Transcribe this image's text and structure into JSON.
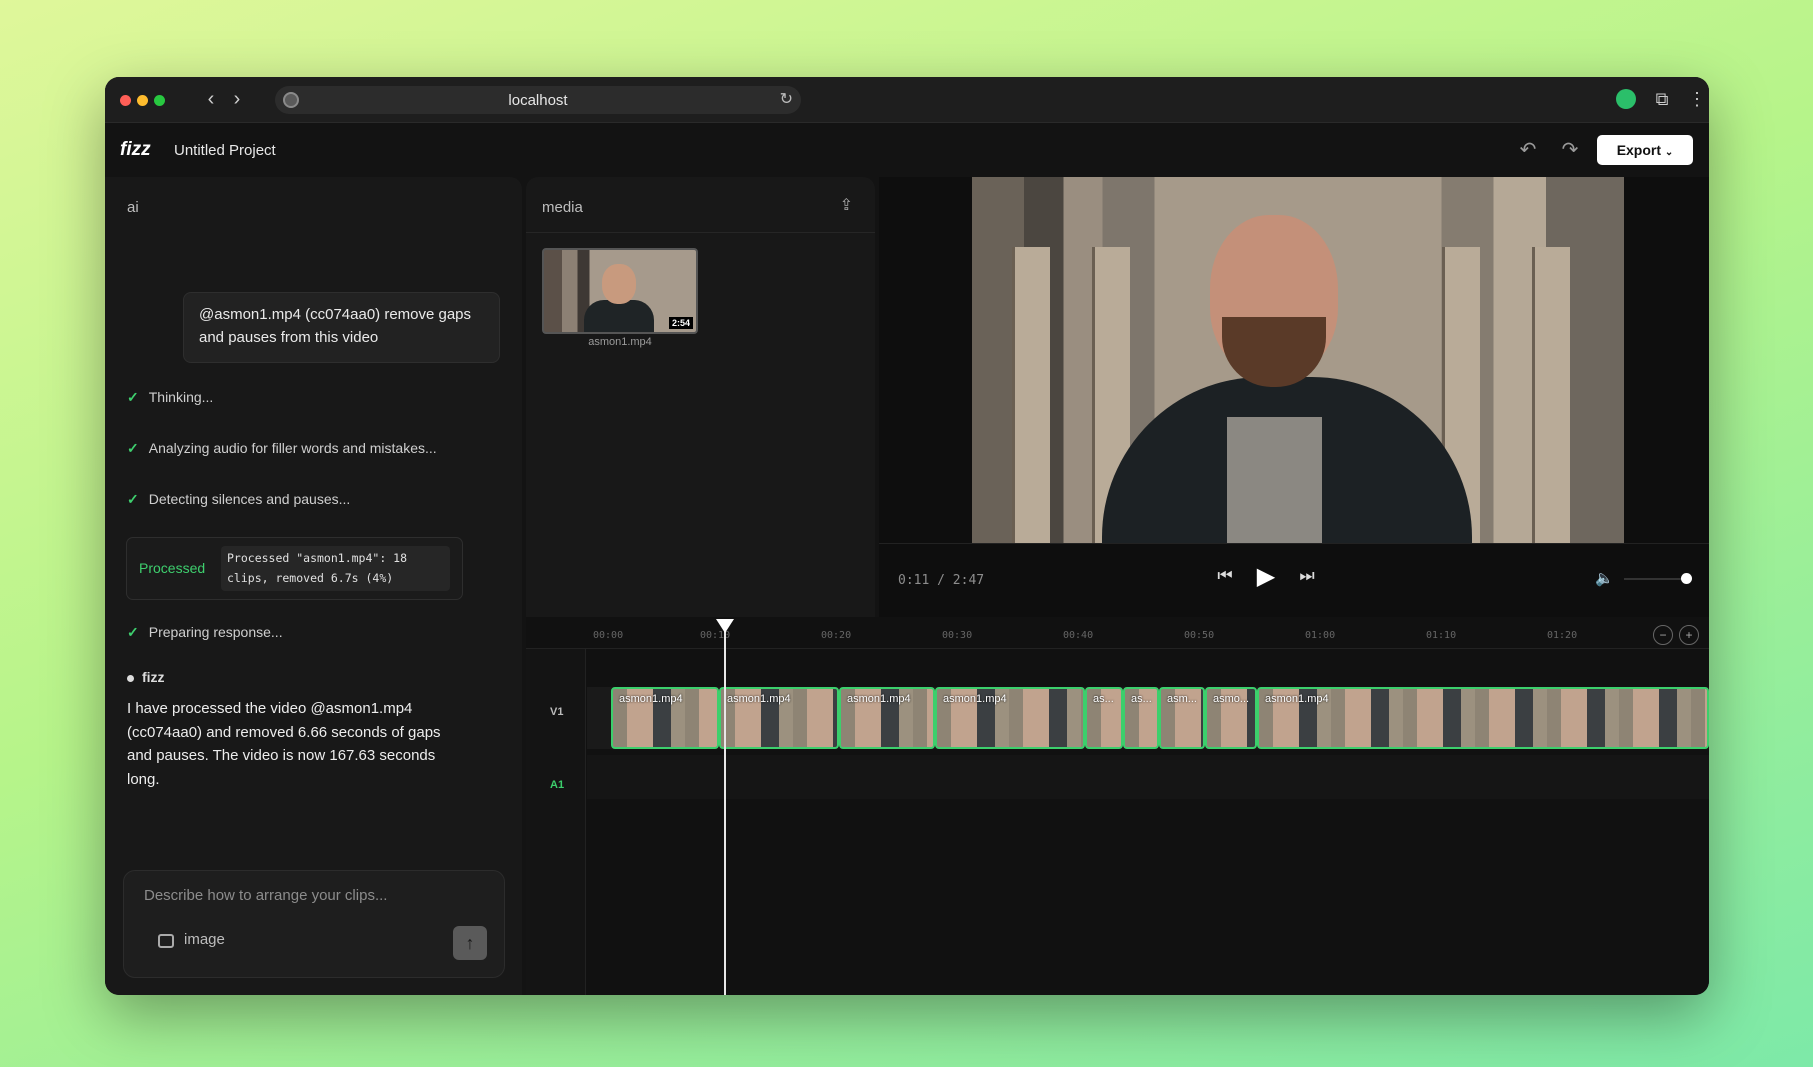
{
  "browser": {
    "url": "localhost",
    "back_icon": "chevron-left",
    "forward_icon": "chevron-right"
  },
  "app": {
    "logo": "fizz",
    "project_name": "Untitled Project",
    "export_label": "Export"
  },
  "ai_panel": {
    "title": "ai",
    "user_message": "@asmon1.mp4 (cc074aa0) remove gaps and pauses from this video",
    "steps": [
      "Thinking...",
      "Analyzing audio for filler words and mistakes...",
      "Detecting silences and pauses..."
    ],
    "processed_label": "Processed",
    "processed_detail": "Processed \"asmon1.mp4\": 18 clips, removed 6.7s (4%)",
    "final_step": "Preparing response...",
    "assistant_name": "fizz",
    "assistant_reply": "I have processed the video @asmon1.mp4 (cc074aa0) and removed 6.66 seconds of gaps and pauses. The video is now 167.63 seconds long.",
    "composer_placeholder": "Describe how to arrange your clips...",
    "image_label": "image"
  },
  "media_panel": {
    "title": "media",
    "items": [
      {
        "name": "asmon1.mp4",
        "duration": "2:54"
      }
    ]
  },
  "player": {
    "timecode": "0:11 / 2:47",
    "volume": 1.0
  },
  "timeline": {
    "ticks": [
      "00:00",
      "00:10",
      "00:20",
      "00:30",
      "00:40",
      "00:50",
      "01:00",
      "01:10",
      "01:20"
    ],
    "tracks": [
      "V1",
      "A1"
    ],
    "clips": [
      "asmon1.mp4",
      "asmon1.mp4",
      "asmon1.mp4",
      "asmon1.mp4",
      "as...",
      "as...",
      "asm...",
      "asmo...",
      "asmon1.mp4"
    ],
    "accent_color": "#3ccf6c"
  }
}
